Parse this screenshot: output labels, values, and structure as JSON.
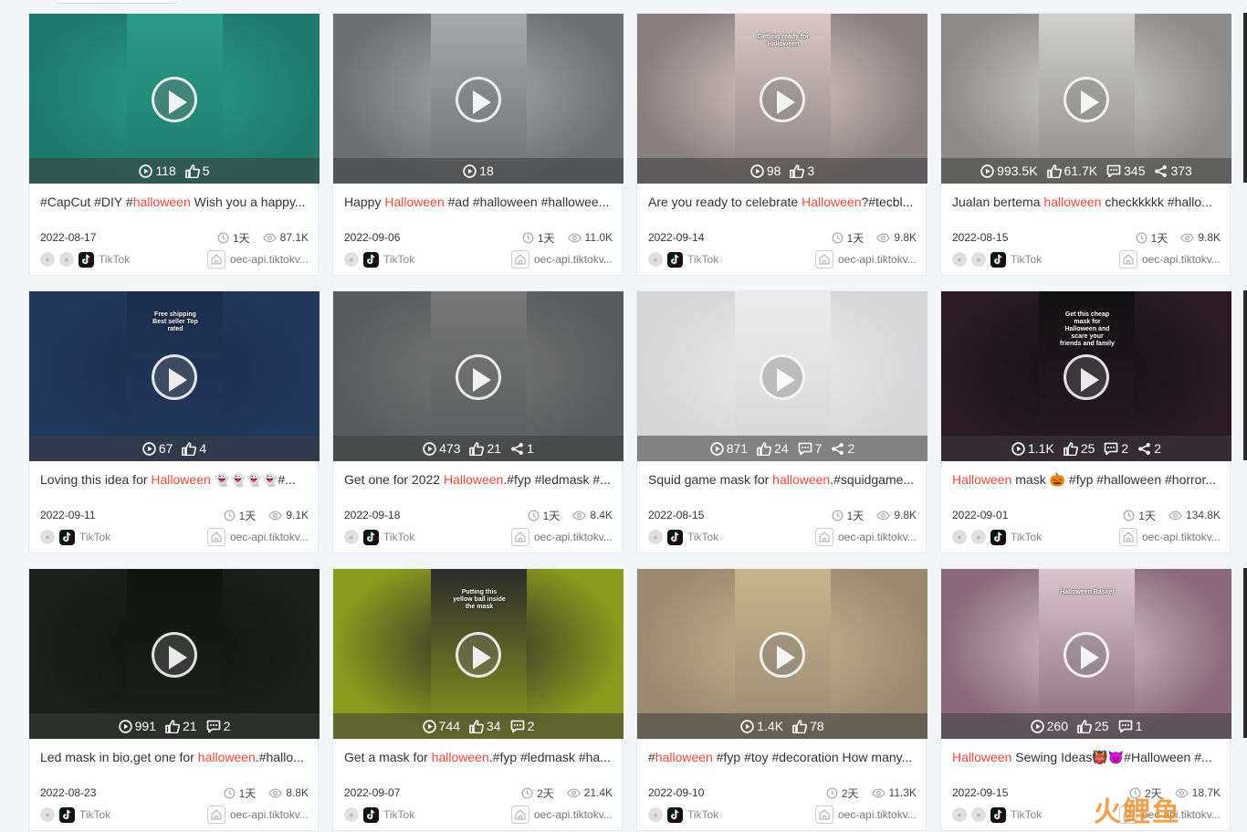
{
  "colors": {
    "highlight": "#f5483b",
    "page_bg": "#f4f5f7"
  },
  "source_label": "TikTok",
  "cards": [
    {
      "pre": "#CapCut #DIY #",
      "hl": "halloween",
      "post": " Wish you a happy...",
      "date": "2022-08-17",
      "age": "1天",
      "views": "87.1K",
      "url": "oec-api.tiktokv...",
      "plays": "118",
      "likes": "5",
      "comments": "",
      "shares": "",
      "bg": "#1f7a6c",
      "phone": "#2a9b86",
      "overlay": "",
      "extra_icon": true
    },
    {
      "pre": "Happy ",
      "hl": "Halloween",
      "post": " #ad #halloween #hallowee...",
      "date": "2022-09-06",
      "age": "1天",
      "views": "11.0K",
      "url": "oec-api.tiktokv...",
      "plays": "18",
      "likes": "",
      "comments": "",
      "shares": "",
      "bg": "#6e6f72",
      "phone": "#a8a9aa",
      "overlay": "",
      "extra_icon": false
    },
    {
      "pre": "Are you ready to celebrate ",
      "hl": "Halloween",
      "post": "?#tecbl...",
      "date": "2022-09-14",
      "age": "1天",
      "views": "9.8K",
      "url": "oec-api.tiktokv...",
      "plays": "98",
      "likes": "3",
      "comments": "",
      "shares": "",
      "bg": "#8a7f80",
      "phone": "#d9c9c6",
      "overlay": "Getting ready for Halloween",
      "extra_icon": false
    },
    {
      "pre": "Jualan bertema ",
      "hl": "halloween",
      "post": " checkkkkk #hallo...",
      "date": "2022-08-15",
      "age": "1天",
      "views": "9.8K",
      "url": "oec-api.tiktokv...",
      "plays": "993.5K",
      "likes": "61.7K",
      "comments": "345",
      "shares": "373",
      "bg": "#8d8c8a",
      "phone": "#cfcfcd",
      "overlay": "",
      "extra_icon": true
    },
    {
      "pre": "Loving this idea for ",
      "hl": "Halloween",
      "post": " 👻👻👻👻#...",
      "date": "2022-09-11",
      "age": "1天",
      "views": "9.1K",
      "url": "oec-api.tiktokv...",
      "plays": "67",
      "likes": "4",
      "comments": "",
      "shares": "",
      "bg": "#22395c",
      "phone": "#1b2d4f",
      "overlay": "Free shipping Best seller Top rated",
      "extra_icon": false
    },
    {
      "pre": "Get one for 2022 ",
      "hl": "Halloween",
      "post": ".#fyp #ledmask #...",
      "date": "2022-09-18",
      "age": "1天",
      "views": "8.4K",
      "url": "oec-api.tiktokv...",
      "plays": "473",
      "likes": "21",
      "comments": "",
      "shares": "1",
      "bg": "#5a5b5c",
      "phone": "#777",
      "overlay": "",
      "extra_icon": false
    },
    {
      "pre": "Squid game mask for ",
      "hl": "halloween",
      "post": ".#squidgame...",
      "date": "2022-08-15",
      "age": "1天",
      "views": "9.8K",
      "url": "oec-api.tiktokv...",
      "plays": "871",
      "likes": "24",
      "comments": "7",
      "shares": "2",
      "bg": "#d6d6d6",
      "phone": "#ececec",
      "overlay": "",
      "extra_icon": false
    },
    {
      "pre": "",
      "hl": "Halloween",
      "post": " mask 🎃 #fyp #halloween #horror...",
      "date": "2022-09-01",
      "age": "1天",
      "views": "134.8K",
      "url": "oec-api.tiktokv...",
      "plays": "1.1K",
      "likes": "25",
      "comments": "2",
      "shares": "2",
      "bg": "#2a1b24",
      "phone": "#111",
      "overlay": "Get this cheap mask for Halloween and scare your friends and family",
      "extra_icon": true
    },
    {
      "pre": "Led mask in bio,get one for ",
      "hl": "halloween",
      "post": ".#hallo...",
      "date": "2022-08-23",
      "age": "1天",
      "views": "8.8K",
      "url": "oec-api.tiktokv...",
      "plays": "991",
      "likes": "21",
      "comments": "2",
      "shares": "",
      "bg": "#1c1f1c",
      "phone": "#101410",
      "overlay": "",
      "extra_icon": false
    },
    {
      "pre": "Get a mask for ",
      "hl": "halloween",
      "post": ".#fyp #ledmask #ha...",
      "date": "2022-09-07",
      "age": "2天",
      "views": "21.4K",
      "url": "oec-api.tiktokv...",
      "plays": "744",
      "likes": "34",
      "comments": "2",
      "shares": "",
      "bg": "#8a9a1e",
      "phone": "#2c2c2c",
      "overlay": "Putting this yellow ball inside the mask",
      "extra_icon": false
    },
    {
      "pre": "#",
      "hl": "halloween",
      "post": " #fyp #toy #decoration How many...",
      "date": "2022-09-10",
      "age": "2天",
      "views": "11.3K",
      "url": "oec-api.tiktokv...",
      "plays": "1.4K",
      "likes": "78",
      "comments": "",
      "shares": "",
      "bg": "#9a8a72",
      "phone": "#c8b48c",
      "overlay": "",
      "extra_icon": false
    },
    {
      "pre": "",
      "hl": "Halloween",
      "post": " Sewing Ideas👹👿#Halloween #...",
      "date": "2022-09-15",
      "age": "2天",
      "views": "18.7K",
      "url": "oec-api.tiktokv...",
      "plays": "260",
      "likes": "25",
      "comments": "1",
      "shares": "",
      "bg": "#8a6a7a",
      "phone": "#d8c6cc",
      "overlay": "Halloween Basket",
      "extra_icon": true
    }
  ]
}
